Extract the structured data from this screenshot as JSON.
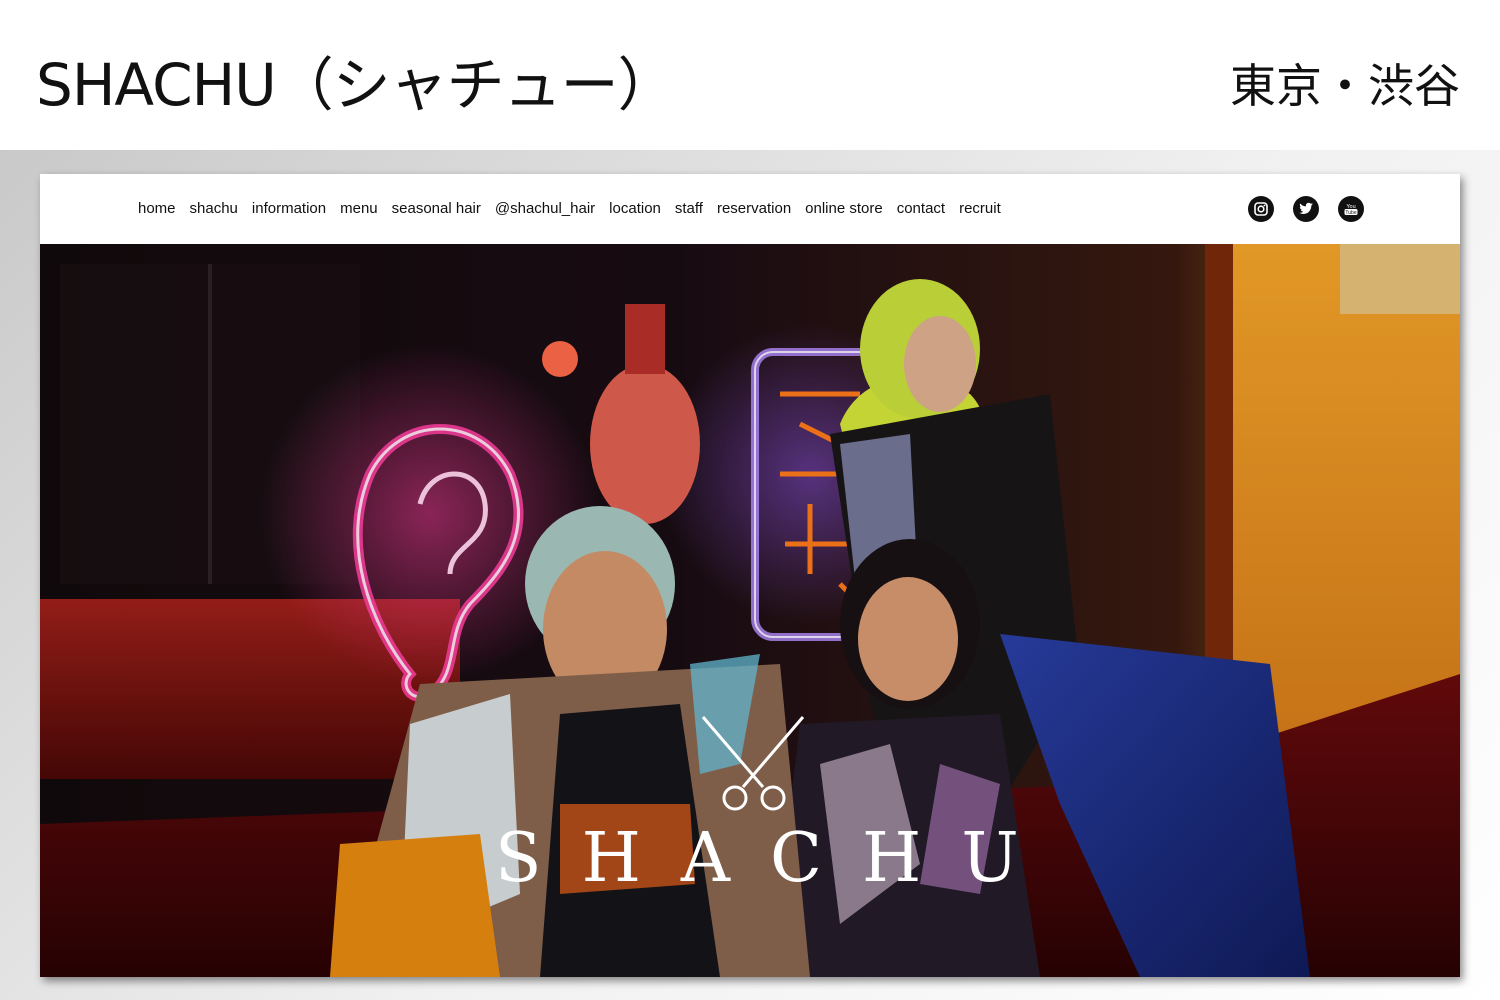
{
  "caption": {
    "title": "SHACHU（シャチュー）",
    "location": "東京・渋谷"
  },
  "nav": {
    "items": [
      {
        "label": "home"
      },
      {
        "label": "shachu"
      },
      {
        "label": "information"
      },
      {
        "label": "menu"
      },
      {
        "label": "seasonal hair"
      },
      {
        "label": "@shachul_hair"
      },
      {
        "label": "location"
      },
      {
        "label": "staff"
      },
      {
        "label": "reservation"
      },
      {
        "label": "online store"
      },
      {
        "label": "contact"
      },
      {
        "label": "recruit"
      }
    ]
  },
  "social": [
    {
      "icon": "instagram-icon"
    },
    {
      "icon": "twitter-icon"
    },
    {
      "icon": "youtube-icon",
      "text": "You Tube"
    }
  ],
  "hero": {
    "brand": "SHACHU"
  }
}
